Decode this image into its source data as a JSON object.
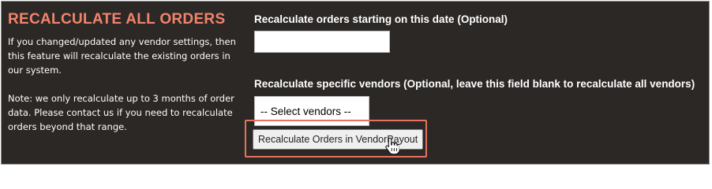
{
  "section": {
    "title": "RECALCULATE ALL ORDERS",
    "description": "If you changed/updated any vendor settings, then this feature will recalculate the existing orders in our system.",
    "note": "Note: we only recalculate up to 3 months of order data. Please contact us if you need to recalculate orders beyond that range."
  },
  "form": {
    "date_label": "Recalculate orders starting on this date (Optional)",
    "date_value": "",
    "vendors_label": "Recalculate specific vendors (Optional, leave this field blank to recalculate all vendors)",
    "vendors_selected": "-- Select vendors --",
    "submit_label": "Recalculate Orders in VendorPayout"
  },
  "icons": {
    "cursor": "hand-pointer-icon"
  },
  "colors": {
    "panel_background": "#2b2826",
    "title_accent": "#f2846d",
    "highlight_border": "#e5735f"
  }
}
